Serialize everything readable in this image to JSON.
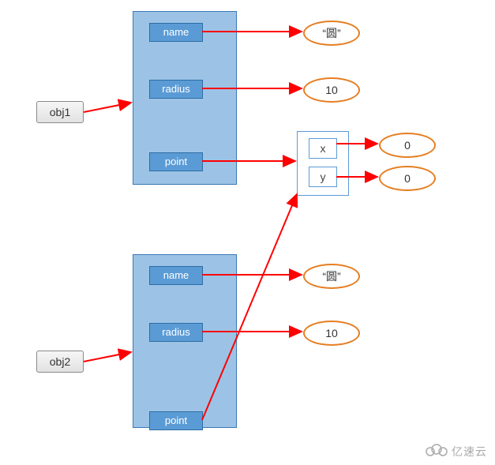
{
  "vars": {
    "obj1": "obj1",
    "obj2": "obj2"
  },
  "obj1": {
    "slots": {
      "name": "name",
      "radius": "radius",
      "point": "point"
    },
    "values": {
      "name": "“圆”",
      "radius": "10"
    }
  },
  "obj2": {
    "slots": {
      "name": "name",
      "radius": "radius",
      "point": "point"
    },
    "values": {
      "name": "“圆”",
      "radius": "10"
    }
  },
  "point": {
    "fields": {
      "x": "x",
      "y": "y"
    },
    "values": {
      "x": "0",
      "y": "0"
    }
  },
  "watermark": "亿速云"
}
